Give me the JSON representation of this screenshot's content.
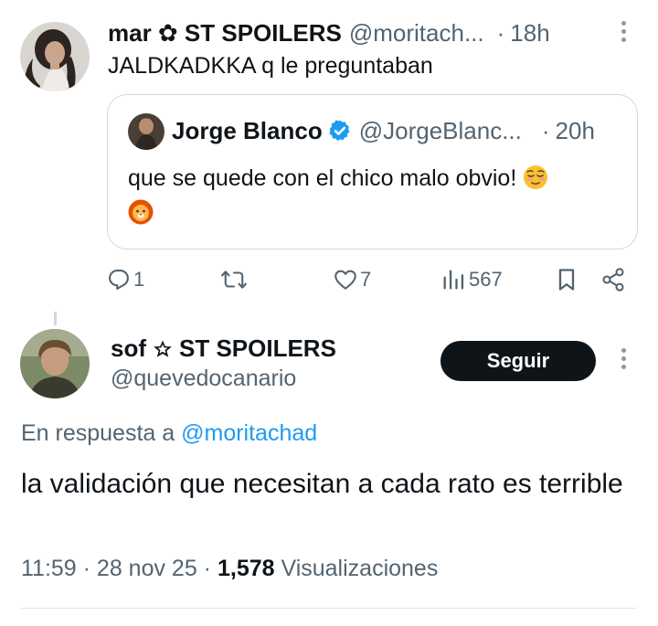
{
  "tweet1": {
    "name": "mar ✿ ST SPOILERS",
    "handle": "@moritach...",
    "dot": "·",
    "time": "18h",
    "text": "JALDKADKKA q le preguntaban",
    "avatar_icon": "profile-photo-woman"
  },
  "quote": {
    "name": "Jorge Blanco",
    "handle": "@JorgeBlanc...",
    "dot": "·",
    "time": "20h",
    "text": "que se quede con el chico malo obvio!",
    "emojis": [
      "relieved-face-emoji",
      "lion-face-emoji"
    ],
    "verified_color": "#1d9bf0"
  },
  "actions": {
    "replies": "1",
    "retweets": "",
    "likes": "7",
    "views": "567"
  },
  "tweet2": {
    "name_part1": "sof",
    "name_part2": "ST SPOILERS",
    "handle": "@quevedocanario",
    "follow_label": "Seguir",
    "reply_prefix": "En respuesta a",
    "reply_mention": "@moritachad",
    "text": "la validación que necesitan a cada rato es terrible",
    "meta_time": "11:59 · 28 nov 25 · ",
    "meta_views_count": "1,578",
    "meta_views_label": " Visualizaciones"
  },
  "colors": {
    "text": "#0f1419",
    "muted": "#536471",
    "link": "#1d9bf0",
    "border": "#cfd9de",
    "button_bg": "#0f1419"
  }
}
